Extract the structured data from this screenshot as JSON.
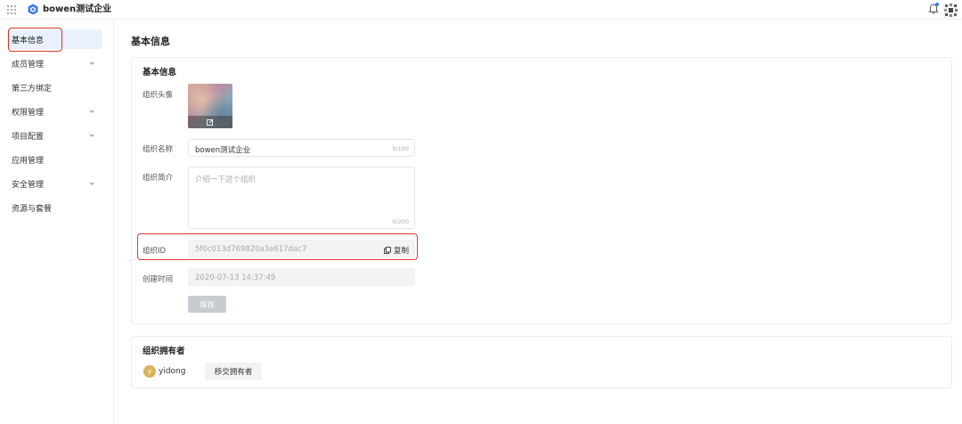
{
  "header": {
    "org_name": "bowen测试企业"
  },
  "sidebar": {
    "items": [
      {
        "label": "基本信息",
        "active": true
      },
      {
        "label": "成员管理",
        "expandable": true
      },
      {
        "label": "第三方绑定"
      },
      {
        "label": "权限管理",
        "expandable": true
      },
      {
        "label": "项目配置",
        "expandable": true
      },
      {
        "label": "应用管理"
      },
      {
        "label": "安全管理",
        "expandable": true
      },
      {
        "label": "资源与套餐"
      }
    ]
  },
  "main": {
    "page_title": "基本信息",
    "basic_card": {
      "title": "基本信息",
      "avatar_label": "组织头像",
      "name_label": "组织名称",
      "name_value": "bowen测试企业",
      "name_count": "9/100",
      "intro_label": "组织简介",
      "intro_placeholder": "介绍一下这个组织",
      "intro_count": "0/200",
      "id_label": "组织ID",
      "id_value": "5f0c013d769820a3e617dac7",
      "copy_label": "复制",
      "created_label": "创建时间",
      "created_value": "2020-07-13 14:37:49",
      "save_label": "保存"
    },
    "owner_card": {
      "title": "组织拥有者",
      "owner_initial": "y",
      "owner_name": "yidong",
      "transfer_label": "移交拥有者"
    }
  },
  "colors": {
    "accent": "#2f7bff",
    "active_bg": "#e8f1fd",
    "highlight_ring": "#d63a2c",
    "disabled_btn": "#c8cbd0",
    "owner_avatar": "#d9b45c"
  },
  "icons": {
    "app_grid": "grid-icon",
    "logo": "org-logo-icon",
    "notification": "bell-icon",
    "edit": "edit-icon",
    "copy": "copy-icon",
    "expand": "chevron-down-icon"
  }
}
